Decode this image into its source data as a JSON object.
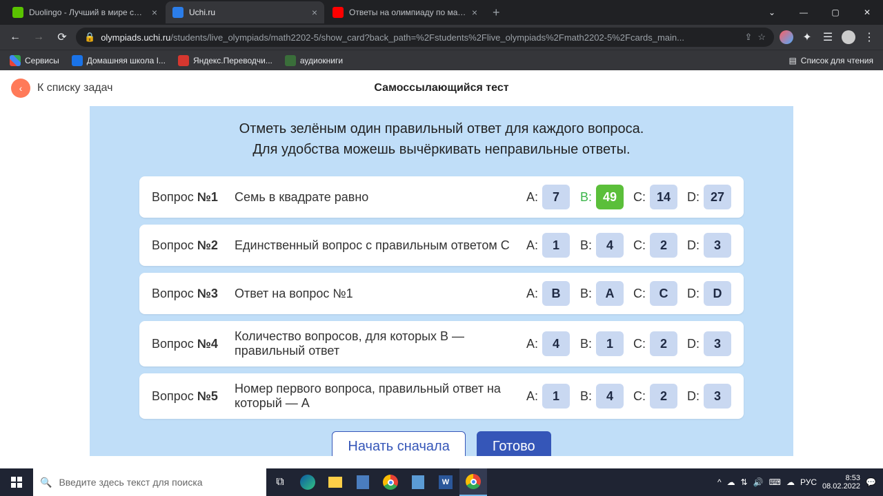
{
  "browser": {
    "tabs": [
      {
        "title": "Duolingo - Лучший в мире спос",
        "favicon": "#5ac300"
      },
      {
        "title": "Uchi.ru",
        "favicon": "#2b7de9",
        "active": true
      },
      {
        "title": "Ответы на олимпиаду по матем",
        "favicon": "#ff0000"
      }
    ],
    "url_host": "olympiads.uchi.ru",
    "url_path": "/students/live_olympiads/math2202-5/show_card?back_path=%2Fstudents%2Flive_olympiads%2Fmath2202-5%2Fcards_main...",
    "bookmarks": [
      {
        "label": "Сервисы",
        "color": "#ff9800"
      },
      {
        "label": "Домашняя школа I...",
        "color": "#1a73e8"
      },
      {
        "label": "Яндекс.Переводчи...",
        "color": "#d5372f"
      },
      {
        "label": "аудиокниги",
        "color": "#3a6e3a"
      }
    ],
    "reading_list": "Список для чтения"
  },
  "page": {
    "back_label": "К списку задач",
    "title": "Самоссылающийся тест",
    "instruction_line1": "Отметь зелёным один правильный ответ для каждого вопроса.",
    "instruction_line2": "Для удобства можешь вычёркивать неправильные ответы.",
    "q_prefix": "Вопрос ",
    "opt_letters": [
      "A:",
      "B:",
      "C:",
      "D:"
    ],
    "questions": [
      {
        "num": "№1",
        "text": "Семь в квадрате равно",
        "opts": [
          "7",
          "49",
          "14",
          "27"
        ],
        "selected": 1
      },
      {
        "num": "№2",
        "text": "Единственный вопрос с правильным ответом С",
        "opts": [
          "1",
          "4",
          "2",
          "3"
        ],
        "selected": -1
      },
      {
        "num": "№3",
        "text": "Ответ на вопрос №1",
        "opts": [
          "B",
          "A",
          "C",
          "D"
        ],
        "selected": -1
      },
      {
        "num": "№4",
        "text": "Количество вопросов, для которых В — правильный ответ",
        "opts": [
          "4",
          "1",
          "2",
          "3"
        ],
        "selected": -1
      },
      {
        "num": "№5",
        "text": "Номер первого вопроса, правильный ответ на который — А",
        "opts": [
          "1",
          "4",
          "2",
          "3"
        ],
        "selected": -1
      }
    ],
    "restart": "Начать сначала",
    "done": "Готово"
  },
  "taskbar": {
    "search_placeholder": "Введите здесь текст для поиска",
    "lang": "РУС",
    "time": "8:53",
    "date": "08.02.2022"
  }
}
